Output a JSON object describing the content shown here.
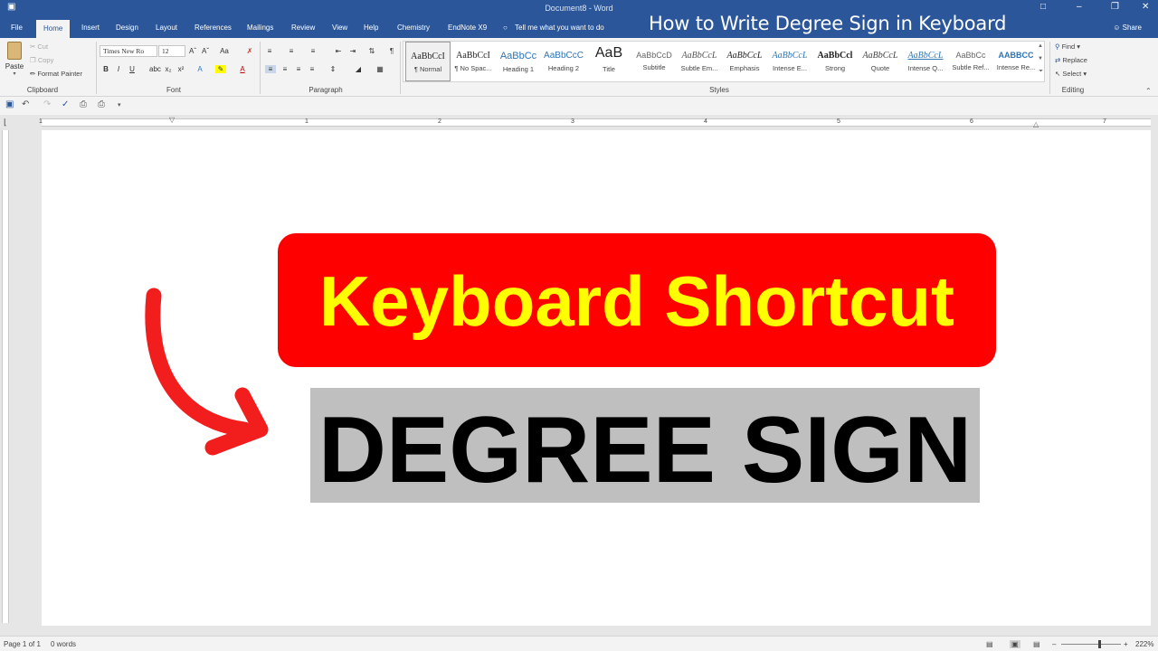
{
  "window": {
    "title": "Document8  -  Word",
    "overlay_title": "How to Write Degree Sign in Keyboard"
  },
  "tabs": {
    "file": "File",
    "home": "Home",
    "insert": "Insert",
    "design": "Design",
    "layout": "Layout",
    "references": "References",
    "mailings": "Mailings",
    "review": "Review",
    "view": "View",
    "help": "Help",
    "chemistry": "Chemistry",
    "endnote": "EndNote X9",
    "tell_me": "Tell me what you want to do",
    "share": "Share"
  },
  "clipboard": {
    "paste": "Paste",
    "cut": "Cut",
    "copy": "Copy",
    "format_painter": "Format Painter",
    "label": "Clipboard"
  },
  "font": {
    "name": "Times New Ro",
    "size": "12",
    "label": "Font"
  },
  "paragraph": {
    "label": "Paragraph"
  },
  "styles": {
    "label": "Styles",
    "items": [
      {
        "preview": "AaBbCcI",
        "name": "¶ Normal"
      },
      {
        "preview": "AaBbCcI",
        "name": "¶ No Spac..."
      },
      {
        "preview": "AaBbCc",
        "name": "Heading 1"
      },
      {
        "preview": "AaBbCcC",
        "name": "Heading 2"
      },
      {
        "preview": "AaB",
        "name": "Title"
      },
      {
        "preview": "AaBbCcD",
        "name": "Subtitle"
      },
      {
        "preview": "AaBbCcL",
        "name": "Subtle Em..."
      },
      {
        "preview": "AaBbCcL",
        "name": "Emphasis"
      },
      {
        "preview": "AaBbCcL",
        "name": "Intense E..."
      },
      {
        "preview": "AaBbCcl",
        "name": "Strong"
      },
      {
        "preview": "AaBbCcL",
        "name": "Quote"
      },
      {
        "preview": "AaBbCcL",
        "name": "Intense Q..."
      },
      {
        "preview": "AaBbCc",
        "name": "Subtle Ref..."
      },
      {
        "preview": "AABBCC",
        "name": "Intense Re..."
      }
    ]
  },
  "editing": {
    "find": "Find",
    "replace": "Replace",
    "select": "Select",
    "label": "Editing"
  },
  "ruler_numbers": [
    "1",
    "1",
    "2",
    "3",
    "4",
    "5",
    "6",
    "7"
  ],
  "document": {
    "banner_text": "Keyboard Shortcut",
    "highlight_text": "DEGREE SIGN"
  },
  "colors": {
    "banner": "#fe0000",
    "banner_text": "#ffff00",
    "highlight": "#bfbfbf",
    "arrow": "#f21d1d",
    "word_blue": "#2b579a"
  },
  "status": {
    "page": "Page 1 of 1",
    "words": "0 words",
    "zoom": "222%"
  }
}
